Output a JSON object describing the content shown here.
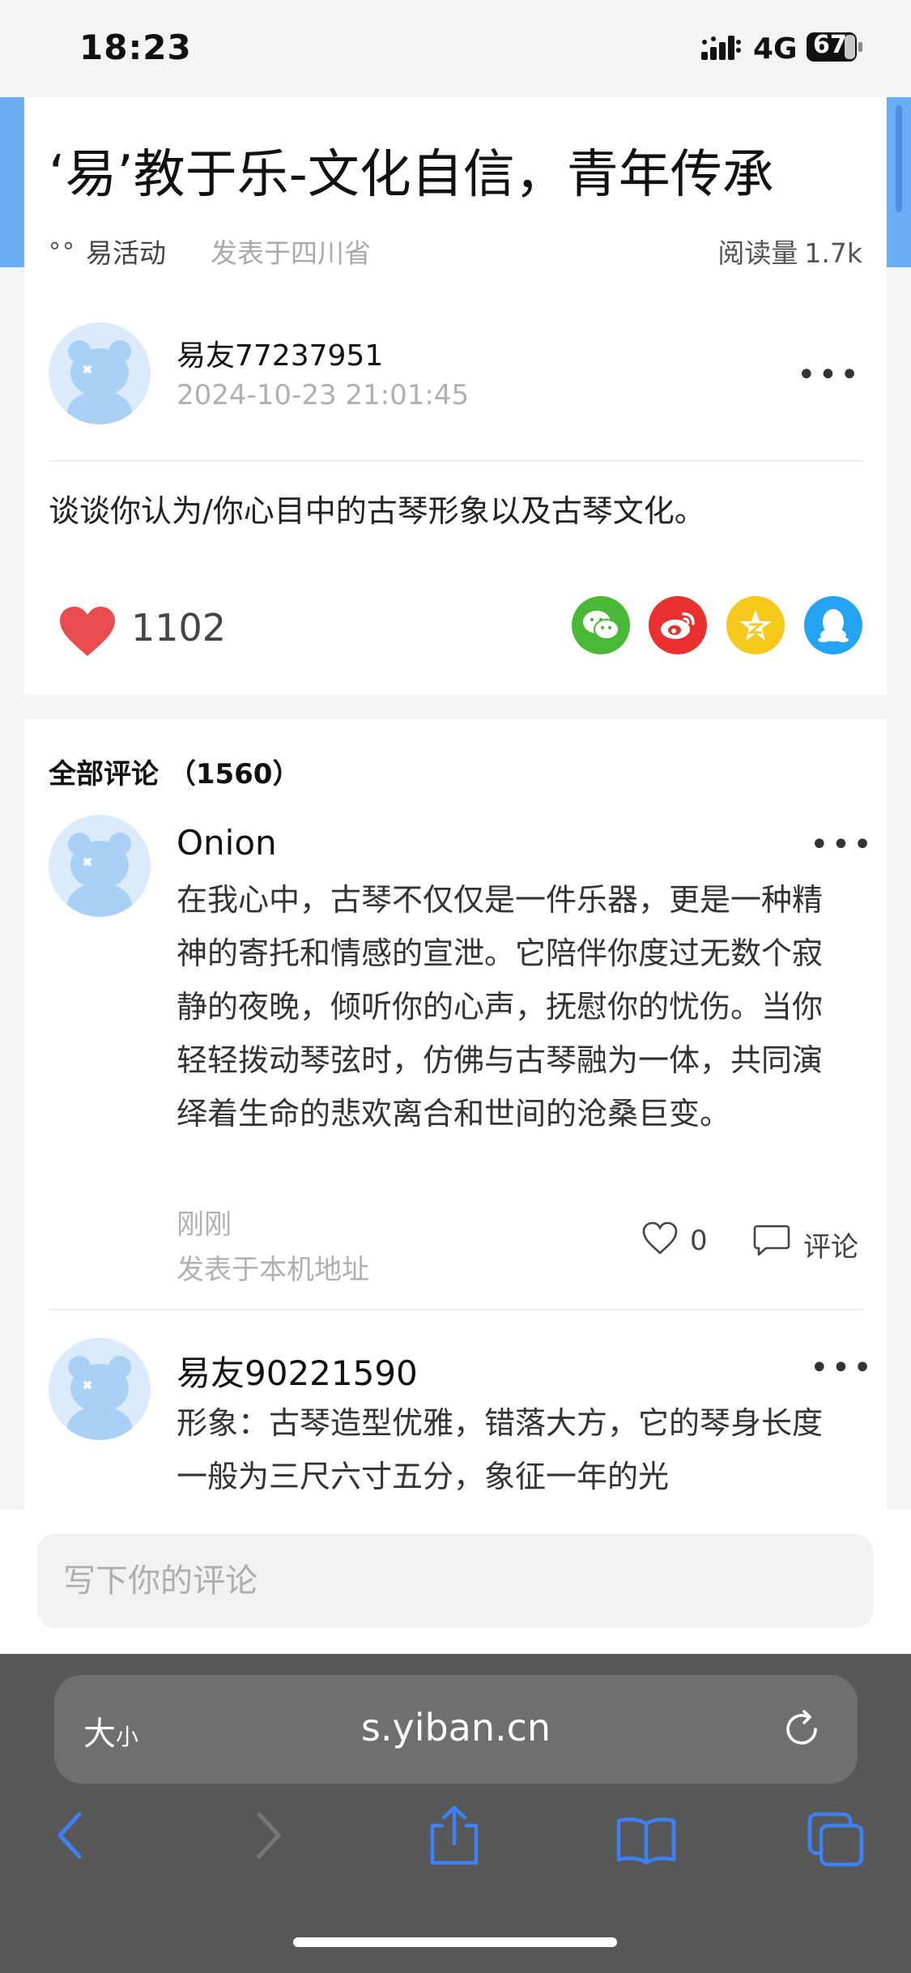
{
  "status_bar": {
    "time": "18:23",
    "network": "4G",
    "battery": "67"
  },
  "post": {
    "title": "‘易’教于乐-文化自信，青年传承",
    "activity_label": "易活动",
    "location": "发表于四川省",
    "read_count_label": "阅读量",
    "read_count": "1.7k",
    "author_name": "易友77237951",
    "author_time": "2024-10-23 21:01:45",
    "more_label": "•••",
    "body": "谈谈你认为/你心目中的古琴形象以及古琴文化。",
    "like_count": "1102",
    "share_icons": [
      "wechat-icon",
      "weibo-icon",
      "qzone-icon",
      "qq-icon"
    ]
  },
  "comments": {
    "header": "全部评论 （1560）",
    "items": [
      {
        "name": "Onion",
        "text": "在我心中，古琴不仅仅是一件乐器，更是一种精神的寄托和情感的宣泄。它陪伴你度过无数个寂静的夜晚，倾听你的心声，抚慰你的忧伤。当你轻轻拨动琴弦时，仿佛与古琴融为一体，共同演绎着生命的悲欢离合和世间的沧桑巨变。",
        "time": "刚刚",
        "location": "发表于本机地址",
        "like_count": "0",
        "reply_label": "评论"
      },
      {
        "name": "易友90221590",
        "text": "形象：古琴造型优雅，错落大方，它的琴身长度一般为三尺六寸五分，象征一年的光"
      }
    ]
  },
  "input": {
    "placeholder": "写下你的评论"
  },
  "browser": {
    "text_size_large": "大",
    "text_size_small": "小",
    "url": "s.yiban.cn"
  },
  "colors": {
    "accent_blue": "#69adf5",
    "like_red": "#e94c4f",
    "toolbar_icon_blue": "#3b82f6"
  }
}
